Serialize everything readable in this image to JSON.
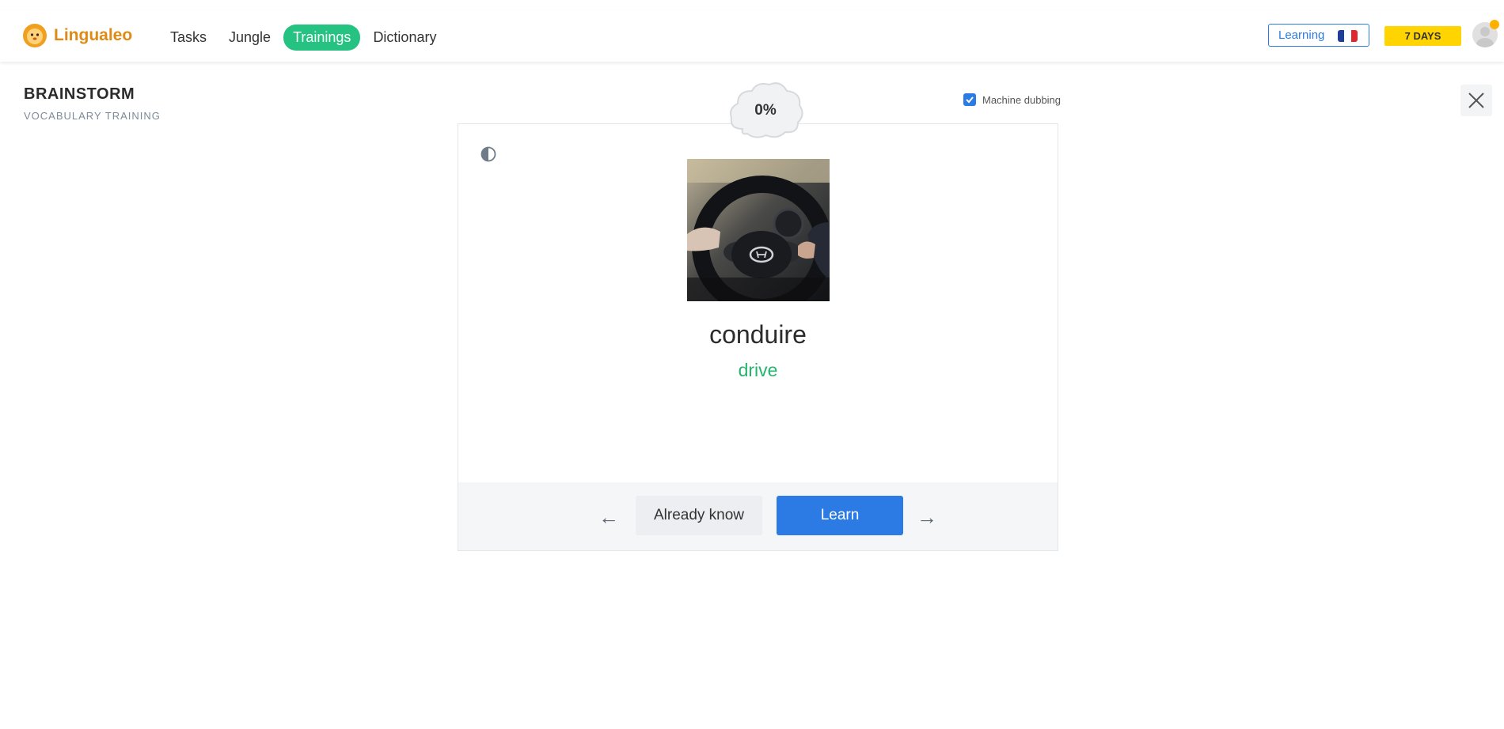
{
  "header": {
    "logo_text": "Lingualeo",
    "nav": [
      {
        "label": "Tasks",
        "active": false
      },
      {
        "label": "Jungle",
        "active": false
      },
      {
        "label": "Trainings",
        "active": true
      },
      {
        "label": "Dictionary",
        "active": false
      }
    ],
    "learning_label": "Learning",
    "learning_flag": "france-flag",
    "days_badge": "7 DAYS",
    "accent_color": "#26c281"
  },
  "page": {
    "title": "BRAINSTORM",
    "subtitle": "VOCABULARY TRAINING"
  },
  "progress": {
    "label": "0%",
    "value": 0
  },
  "options": {
    "machine_dubbing_label": "Machine dubbing",
    "machine_dubbing_checked": true
  },
  "card": {
    "word": "conduire",
    "translation": "drive",
    "image_alt": "steering-wheel-photo",
    "prev_arrow": "←",
    "next_arrow": "→",
    "already_know_label": "Already know",
    "learn_label": "Learn"
  },
  "colors": {
    "primary_blue": "#2c7be5",
    "translation_green": "#26b36e",
    "badge_yellow": "#ffd400",
    "logo_orange": "#e08a16"
  }
}
